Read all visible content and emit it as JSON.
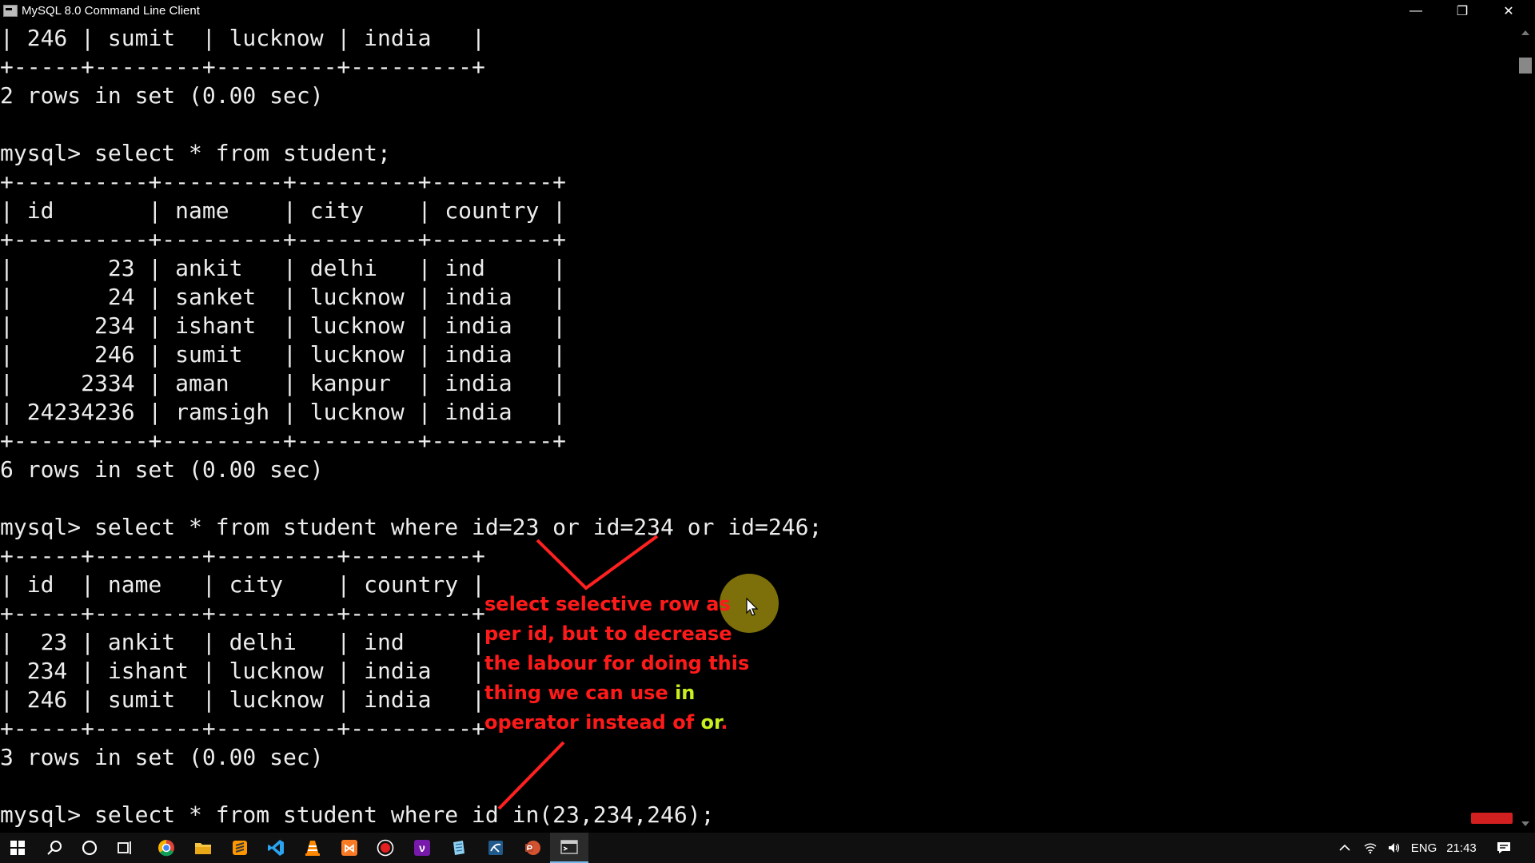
{
  "window": {
    "title": "MySQL 8.0 Command Line Client",
    "controls": [
      "minimize",
      "maximize",
      "close"
    ]
  },
  "terminal": {
    "lines": [
      "| 246 | sumit  | lucknow | india   |",
      "+-----+--------+---------+---------+",
      "2 rows in set (0.00 sec)",
      "",
      "mysql> select * from student;",
      "+----------+---------+---------+---------+",
      "| id       | name    | city    | country |",
      "+----------+---------+---------+---------+",
      "|       23 | ankit   | delhi   | ind     |",
      "|       24 | sanket  | lucknow | india   |",
      "|      234 | ishant  | lucknow | india   |",
      "|      246 | sumit   | lucknow | india   |",
      "|     2334 | aman    | kanpur  | india   |",
      "| 24234236 | ramsigh | lucknow | india   |",
      "+----------+---------+---------+---------+",
      "6 rows in set (0.00 sec)",
      "",
      "mysql> select * from student where id=23 or id=234 or id=246;",
      "+-----+--------+---------+---------+",
      "| id  | name   | city    | country |",
      "+-----+--------+---------+---------+",
      "|  23 | ankit  | delhi   | ind     |",
      "| 234 | ishant | lucknow | india   |",
      "| 246 | sumit  | lucknow | india   |",
      "+-----+--------+---------+---------+",
      "3 rows in set (0.00 sec)",
      "",
      "mysql> select * from student where id in(23,234,246);"
    ]
  },
  "annotation": {
    "line1": "select selective row as",
    "line2": "per id, but to decrease",
    "line3": "the labour for doing this",
    "line4_prefix": "thing we can use ",
    "keyword_in": "in",
    "line5_prefix": "operator instead of ",
    "keyword_or": "or",
    "line5_suffix": ".",
    "text_color": "#ff1a1a",
    "keyword_color": "#c8f020"
  },
  "taskbar": {
    "icons": [
      "windows-start-icon",
      "search-icon",
      "cortana-icon",
      "task-view-icon",
      "chrome-icon",
      "file-explorer-icon",
      "sublime-text-icon",
      "vscode-icon",
      "vlc-icon",
      "xampp-icon",
      "screen-recorder-icon",
      "onenote-icon",
      "notepad-icon",
      "mysql-workbench-icon",
      "powerpoint-icon",
      "mysql-console-icon"
    ],
    "tray": {
      "language": "ENG",
      "time": "21:43"
    }
  }
}
